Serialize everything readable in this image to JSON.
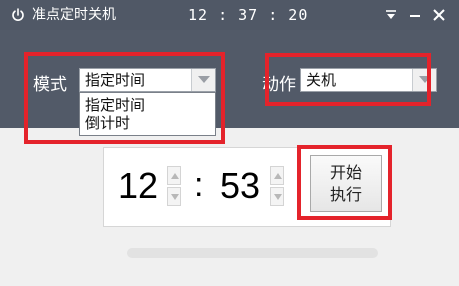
{
  "window": {
    "title": "准点定时关机",
    "clock": "12 : 37 : 20",
    "buttons": [
      "dropdown-icon",
      "minimize-icon",
      "close-icon"
    ],
    "titlebar_color": "#505866"
  },
  "settings": {
    "mode_label": "模式",
    "mode_value": "指定时间",
    "mode_options": [
      "指定时间",
      "倒计时"
    ],
    "action_label": "动作",
    "action_value": "关机"
  },
  "timer": {
    "hour": "12",
    "colon": ":",
    "minute": "53",
    "start_line_1": "开始",
    "start_line_2": "执行"
  },
  "progress": {
    "value": 0
  },
  "annotation_color": "#e4232b"
}
